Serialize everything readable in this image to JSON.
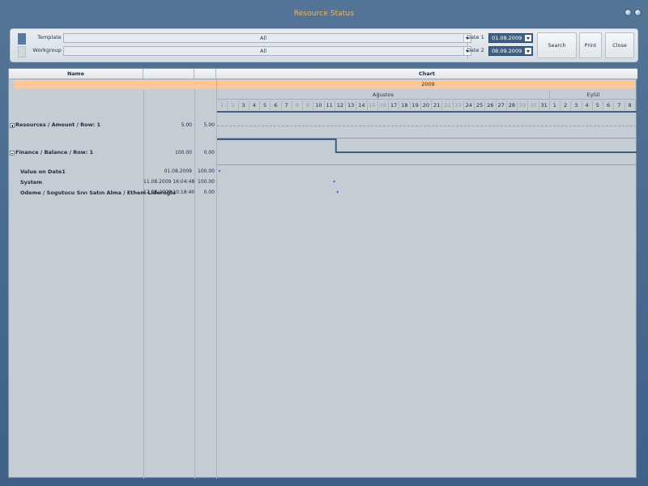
{
  "window": {
    "title": "Resource Status"
  },
  "toolbar": {
    "template_label": "Template :",
    "template_value": "All",
    "workgroup_label": "Workgroup :",
    "workgroup_value": "All",
    "date1_label": "Date 1 :",
    "date1_value": "01.08.2009",
    "date2_label": "Date 2 :",
    "date2_value": "08.09.2009",
    "search_label": "Search",
    "print_label": "Print",
    "close_label": "Close"
  },
  "grid": {
    "col_name": "Name",
    "col_chart": "Chart",
    "year": "2009",
    "months": [
      "Ağustos",
      "Eylül"
    ],
    "days_aug": [
      "1",
      "2",
      "3",
      "4",
      "5",
      "6",
      "7",
      "8",
      "9",
      "10",
      "11",
      "12",
      "13",
      "14",
      "15",
      "16",
      "17",
      "18",
      "19",
      "20",
      "21",
      "22",
      "23",
      "24",
      "25",
      "26",
      "27",
      "28",
      "29",
      "30",
      "31"
    ],
    "days_sep": [
      "1",
      "2",
      "3",
      "4",
      "5",
      "6",
      "7",
      "8"
    ],
    "rows": [
      {
        "label": "Resources / Amount / Row: 1",
        "value": "5.00",
        "scale": "5.00"
      },
      {
        "label": "Finance / Balance / Row: 1",
        "value": "100.00",
        "scale": "0.00"
      }
    ],
    "sub_rows": [
      {
        "label": "Value on Date1",
        "date": "01.08.2009",
        "amount": "100.00"
      },
      {
        "label": "System",
        "date": "11.08.2009 16:04:48",
        "amount": "100.00"
      },
      {
        "label": "Odeme / Sogutucu Sıvı Satın Alma / Ethem Lideroğlu",
        "date": "12.08.2009 10:18:40",
        "amount": "0.00"
      }
    ]
  },
  "colors": {
    "accent_title": "#f1b563",
    "year_bar": "#fdc79a",
    "date_field": "#3f5f83",
    "chart_line": "#3f5f83",
    "point_marker": "#3a6fd8"
  },
  "series": {
    "finance_balance_step_day": 12,
    "finance_balance_before": 100,
    "finance_balance_after": 0,
    "points_day": [
      1,
      11,
      12
    ]
  }
}
